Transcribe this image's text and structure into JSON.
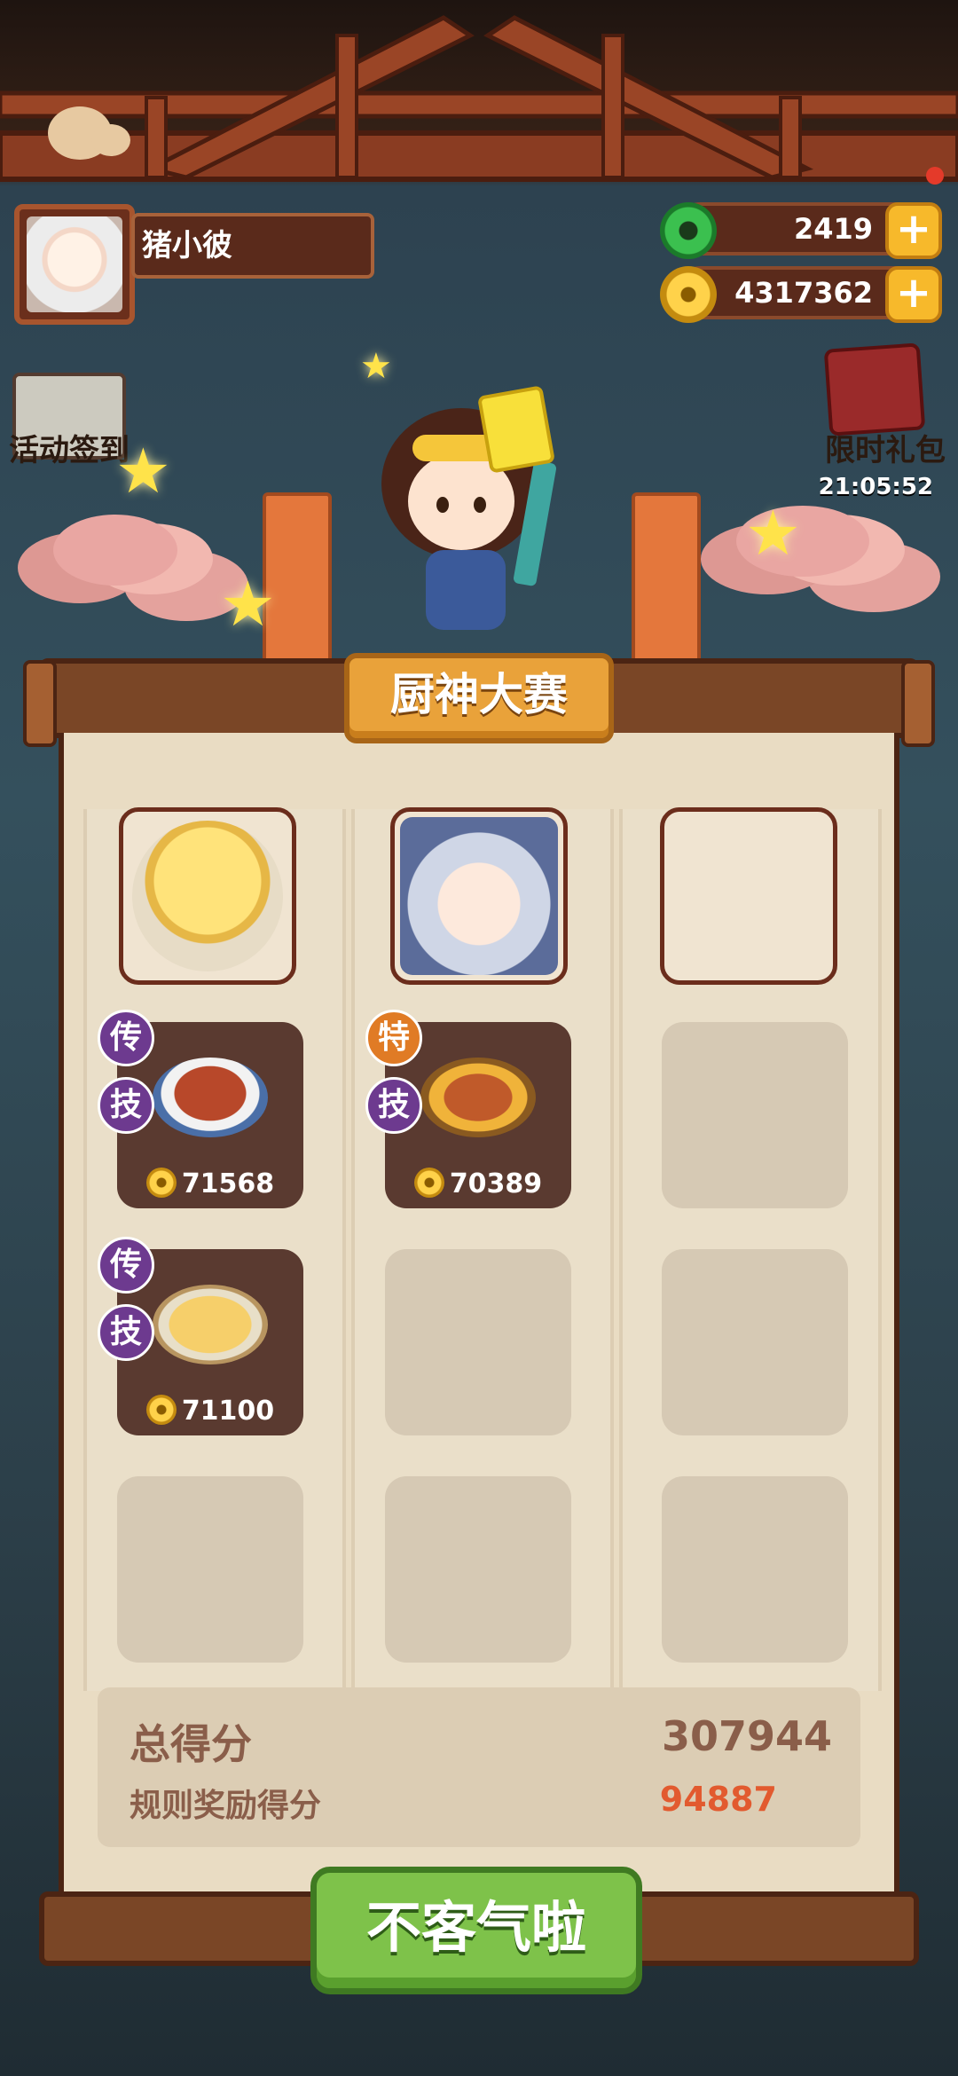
{
  "player": {
    "name": "猪小彼"
  },
  "resources": {
    "jade": "2419",
    "gold": "4317362",
    "add_symbol": "+"
  },
  "side_events": {
    "left_label": "活动签到",
    "right_label": "限时礼包",
    "right_timer": "21:05:52"
  },
  "panel": {
    "title": "厨神大赛",
    "dishes": [
      {
        "badge_top": "传",
        "badge_skill": "技",
        "price": "71568"
      },
      {
        "badge_top": "特",
        "badge_skill": "技",
        "price": "70389"
      },
      {
        "badge_top": "传",
        "badge_skill": "技",
        "price": "71100"
      }
    ],
    "total_label": "总得分",
    "total_value": "307944",
    "bonus_label": "规则奖励得分",
    "bonus_value": "94887"
  },
  "confirm_button": "不客气啦",
  "colors": {
    "accent_gold": "#e9a23a",
    "button_green": "#7ec24a",
    "bonus_red": "#e25a2f"
  }
}
